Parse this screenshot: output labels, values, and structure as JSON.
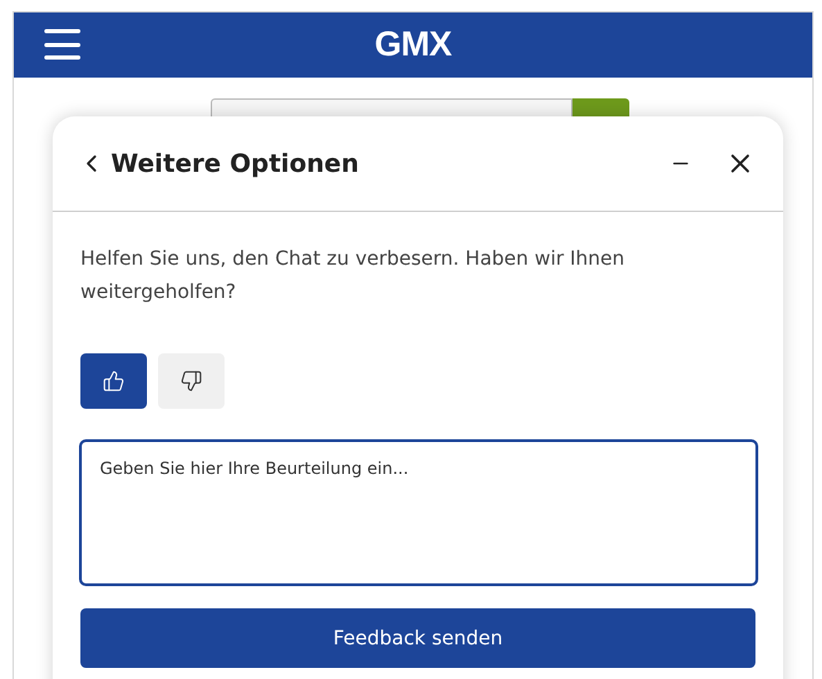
{
  "header": {
    "logo": "GMX"
  },
  "dialog": {
    "title": "Weitere Optionen",
    "question": "Helfen Sie uns, den Chat zu verbesern. Haben wir Ihnen weitergeholfen?",
    "ratings": [
      {
        "kind": "up",
        "selected": true
      },
      {
        "kind": "down",
        "selected": false
      }
    ],
    "feedback": {
      "placeholder": "Geben Sie hier Ihre Beurteilung ein..."
    },
    "submit": "Feedback senden"
  }
}
